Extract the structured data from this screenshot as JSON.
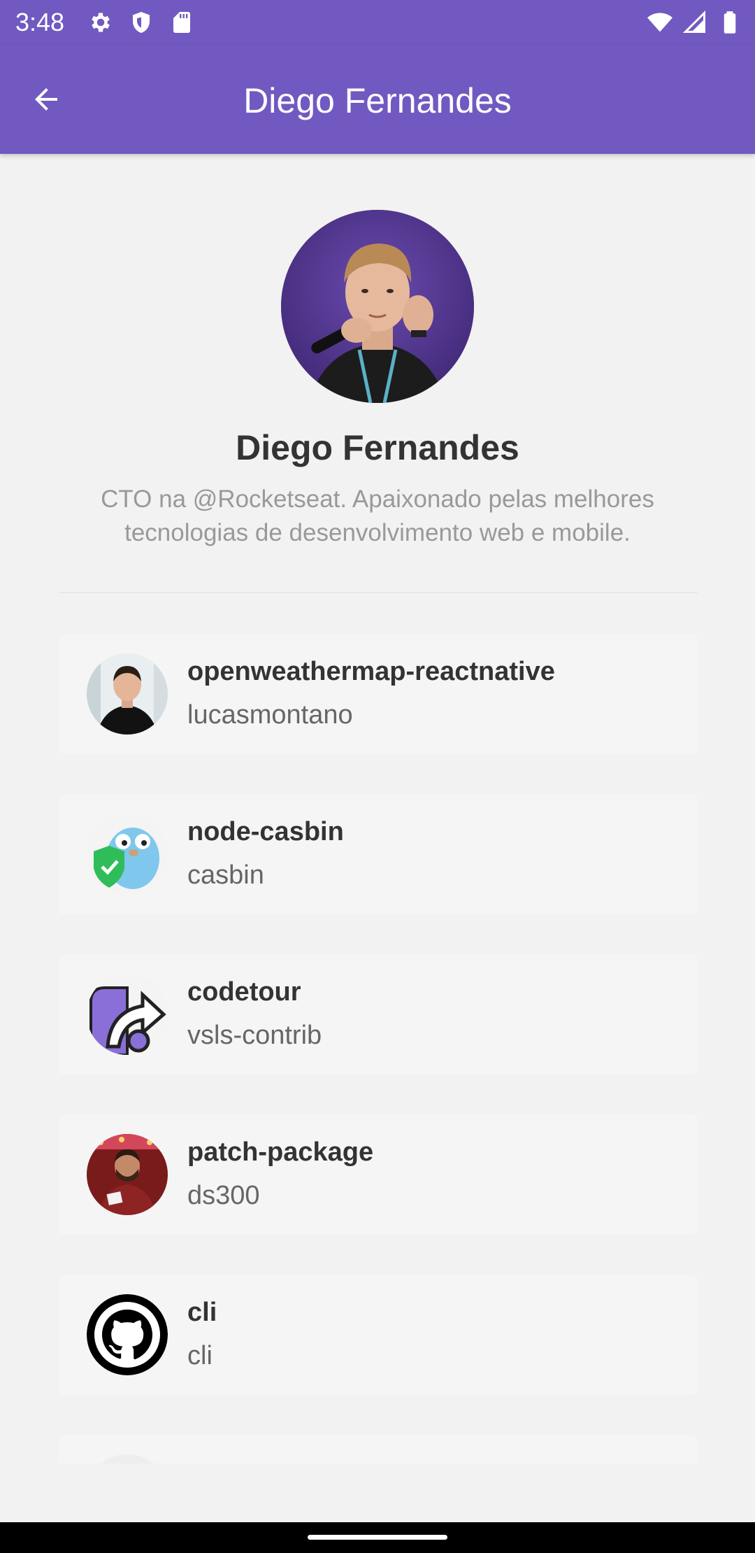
{
  "status_bar": {
    "time": "3:48",
    "left_icons": [
      "settings-icon",
      "shield-icon",
      "sd-card-icon"
    ],
    "right_icons": [
      "wifi-icon",
      "signal-icon",
      "battery-icon"
    ]
  },
  "app_bar": {
    "title": "Diego Fernandes",
    "back_icon": "arrow-left-icon"
  },
  "profile": {
    "name": "Diego Fernandes",
    "bio": "CTO na @Rocketseat. Apaixonado pelas melhores tecnologias de desenvolvimento web e mobile."
  },
  "starred": [
    {
      "title": "openweathermap-reactnative",
      "author": "lucasmontano",
      "avatar": "photo-man-black-shirt"
    },
    {
      "title": "node-casbin",
      "author": "casbin",
      "avatar": "gopher-shield-logo"
    },
    {
      "title": "codetour",
      "author": "vsls-contrib",
      "avatar": "codetour-logo"
    },
    {
      "title": "patch-package",
      "author": "ds300",
      "avatar": "photo-man-red-jacket"
    },
    {
      "title": "cli",
      "author": "cli",
      "avatar": "github-octocat-logo"
    },
    {
      "title": "",
      "author": "",
      "avatar": "partial-avatar"
    }
  ],
  "colors": {
    "primary": "#7159c1",
    "background": "#f2f2f2",
    "card": "#f5f5f5",
    "title_text": "#333333",
    "secondary_text": "#666666",
    "bio_text": "#999999"
  }
}
